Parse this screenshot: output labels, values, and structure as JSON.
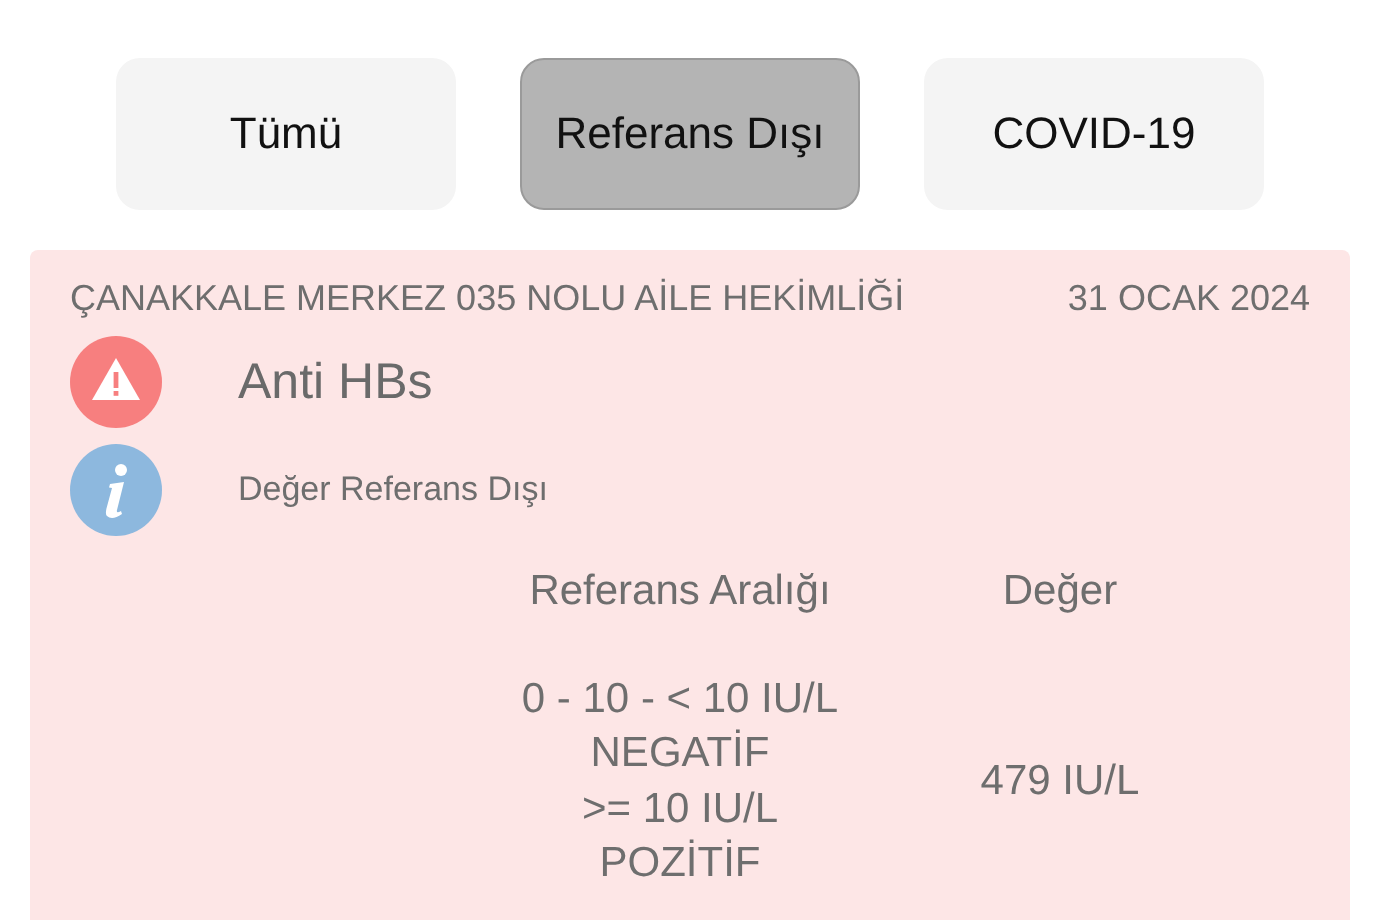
{
  "tabs": [
    {
      "label": "Tümü",
      "selected": false
    },
    {
      "label": "Referans Dışı",
      "selected": true
    },
    {
      "label": "COVID-19",
      "selected": false
    }
  ],
  "result": {
    "facility": "ÇANAKKALE MERKEZ 035 NOLU AİLE HEKİMLİĞİ",
    "date": "31 OCAK 2024",
    "test": "Anti HBs",
    "note": "Değer Referans Dışı",
    "columns": [
      "Referans Aralığı",
      "Değer"
    ],
    "range": "0 - 10 - < 10 IU/L\nNEGATİF\n>= 10 IU/L\nPOZİTİF",
    "value": "479 IU/L"
  }
}
